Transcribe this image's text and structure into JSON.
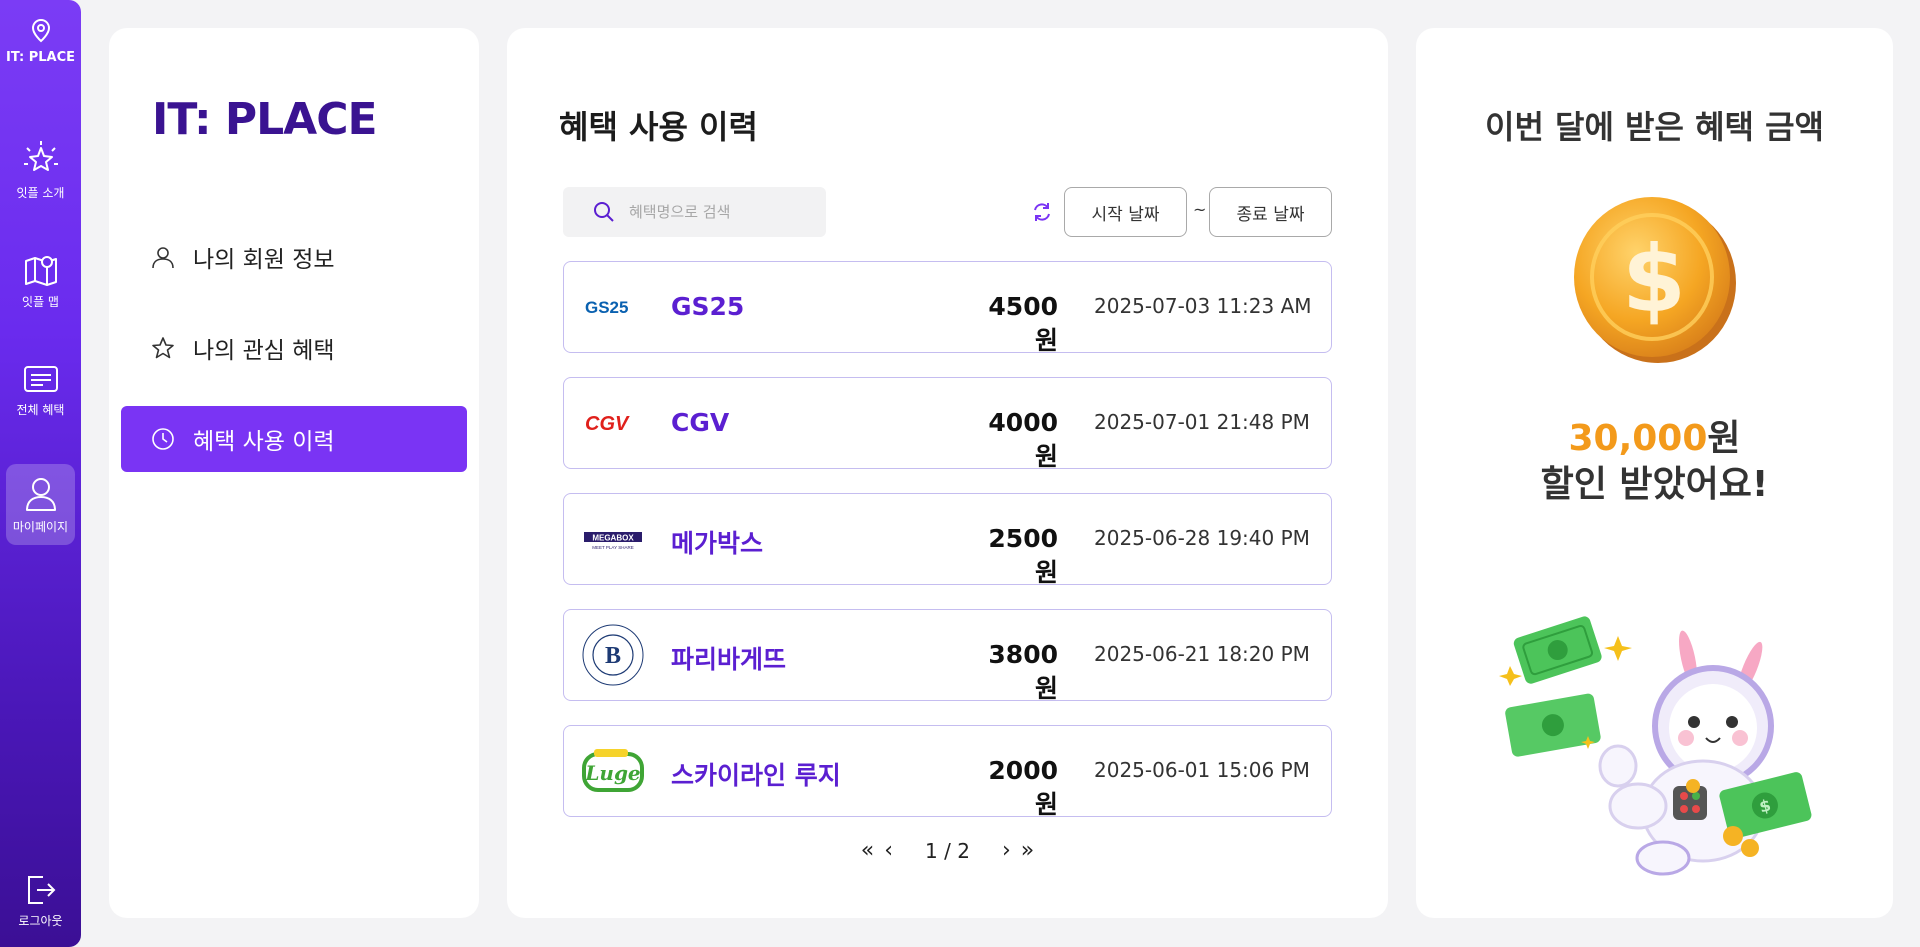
{
  "rail": {
    "brand": "IT: PLACE",
    "items": [
      {
        "label": "잇플 소개",
        "icon": "sparkle-icon"
      },
      {
        "label": "잇플 맵",
        "icon": "map-icon"
      },
      {
        "label": "전체 혜택",
        "icon": "list-icon"
      },
      {
        "label": "마이페이지",
        "icon": "user-icon",
        "active": true
      }
    ],
    "logout": "로그아웃"
  },
  "nav": {
    "logo": "IT: PLACE",
    "items": [
      {
        "label": "나의 회원 정보",
        "icon": "user-icon"
      },
      {
        "label": "나의 관심 혜택",
        "icon": "star-icon"
      },
      {
        "label": "혜택 사용 이력",
        "icon": "clock-icon",
        "active": true
      }
    ]
  },
  "main": {
    "title": "혜택 사용 이력",
    "search_placeholder": "혜택명으로 검색",
    "start_date": "시작 날짜",
    "end_date": "종료 날짜",
    "tilde": "~",
    "rows": [
      {
        "brand": "GS25",
        "logo": "GS25",
        "amount": "4500 원",
        "date": "2025-07-03 11:23 AM"
      },
      {
        "brand": "CGV",
        "logo": "CGV",
        "amount": "4000 원",
        "date": "2025-07-01 21:48 PM"
      },
      {
        "brand": "메가박스",
        "logo": "MEGABOX",
        "logo_sub": "MEET PLAY SHARE",
        "amount": "2500 원",
        "date": "2025-06-28 19:40 PM"
      },
      {
        "brand": "파리바게뜨",
        "logo": "B",
        "amount": "3800 원",
        "date": "2025-06-21 18:20 PM"
      },
      {
        "brand": "스카이라인 루지",
        "logo": "Luge",
        "amount": "2000 원",
        "date": "2025-06-01 15:06 PM"
      }
    ],
    "pager": {
      "text": "1 / 2",
      "first": "«",
      "prev": "‹",
      "next": "›",
      "last": "»"
    }
  },
  "side": {
    "title": "이번 달에 받은 혜택 금액",
    "amount": "30,000",
    "unit": "원",
    "line2": "할인 받았어요!"
  },
  "colors": {
    "accent": "#7a34f4",
    "brand_dark": "#3a1391",
    "highlight": "#f39a1b"
  }
}
